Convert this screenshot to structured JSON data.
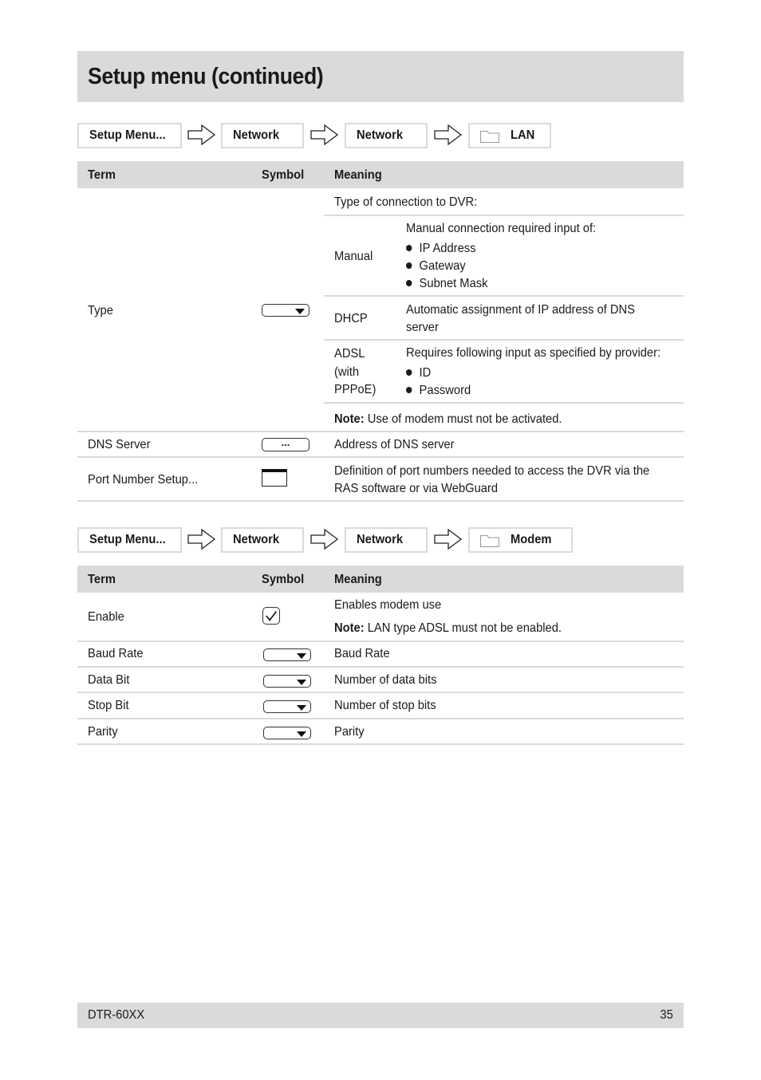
{
  "page": {
    "title": "Setup menu (continued)",
    "footer": {
      "model": "DTR-60XX",
      "page_number": "35"
    }
  },
  "lan_section": {
    "breadcrumb": [
      {
        "label": "Setup Menu...",
        "icon": null
      },
      {
        "label": "Network",
        "icon": null
      },
      {
        "label": "Network",
        "icon": null
      },
      {
        "label": "LAN",
        "icon": "folder-icon"
      }
    ],
    "headers": {
      "term": "Term",
      "symbol": "Symbol",
      "meaning": "Meaning"
    },
    "type_row": {
      "term": "Type",
      "symbol": "dropdown-icon",
      "intro": "Type of connection to DVR:",
      "options": [
        {
          "name": "Manual",
          "desc": "Manual connection required input of:",
          "bullets": [
            "IP Address",
            "Gateway",
            "Subnet Mask"
          ]
        },
        {
          "name": "DHCP",
          "desc_line1": "Automatic assignment of IP address of DNS",
          "desc_line2": "server"
        },
        {
          "name_line1": "ADSL",
          "name_line2": "(with",
          "name_line3": "PPPoE)",
          "desc": "Requires following input as specified by provider:",
          "bullets": [
            "ID",
            "Password"
          ]
        }
      ],
      "note_label": "Note:",
      "note_text": " Use of modem must not be activated."
    },
    "rows": [
      {
        "term": "DNS Server",
        "symbol": "ellipsis-button-icon",
        "symbol_text": "...",
        "meaning": "Address of DNS server"
      },
      {
        "term": "Port Number Setup...",
        "symbol": "window-icon",
        "meaning_line1": "Definition of port numbers needed to access the DVR via the",
        "meaning_line2": "RAS software or via WebGuard"
      }
    ]
  },
  "modem_section": {
    "breadcrumb": [
      {
        "label": "Setup Menu...",
        "icon": null
      },
      {
        "label": "Network",
        "icon": null
      },
      {
        "label": "Network",
        "icon": null
      },
      {
        "label": "Modem",
        "icon": "folder-icon"
      }
    ],
    "headers": {
      "term": "Term",
      "symbol": "Symbol",
      "meaning": "Meaning"
    },
    "enable_row": {
      "term": "Enable",
      "symbol": "checkbox-icon",
      "meaning": "Enables modem use",
      "note_label": "Note:",
      "note_text": " LAN type ADSL must not be enabled."
    },
    "rows": [
      {
        "term": "Baud Rate",
        "symbol": "dropdown-icon",
        "meaning": "Baud Rate"
      },
      {
        "term": "Data Bit",
        "symbol": "dropdown-icon",
        "meaning": "Number of data bits"
      },
      {
        "term": "Stop Bit",
        "symbol": "dropdown-icon",
        "meaning": "Number of stop bits"
      },
      {
        "term": "Parity",
        "symbol": "dropdown-icon",
        "meaning": "Parity"
      }
    ]
  }
}
